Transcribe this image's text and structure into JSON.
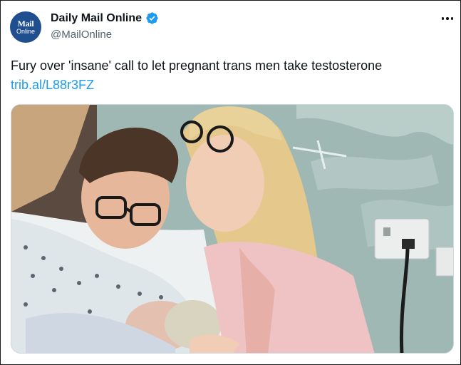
{
  "account": {
    "display_name": "Daily Mail Online",
    "handle": "@MailOnline",
    "avatar_line1": "Mail",
    "avatar_line2": "Online",
    "verified_color": "#1d9bf0"
  },
  "tweet": {
    "text": "Fury over 'insane' call to let pregnant trans men take testosterone",
    "link": "trib.al/L88r3FZ"
  },
  "icons": {
    "more": "more-horizontal-icon",
    "verified": "verified-badge-icon"
  },
  "colors": {
    "link": "#1d9bf0",
    "text": "#0f1419",
    "secondary": "#536471",
    "wall": "#9fb8b4"
  }
}
